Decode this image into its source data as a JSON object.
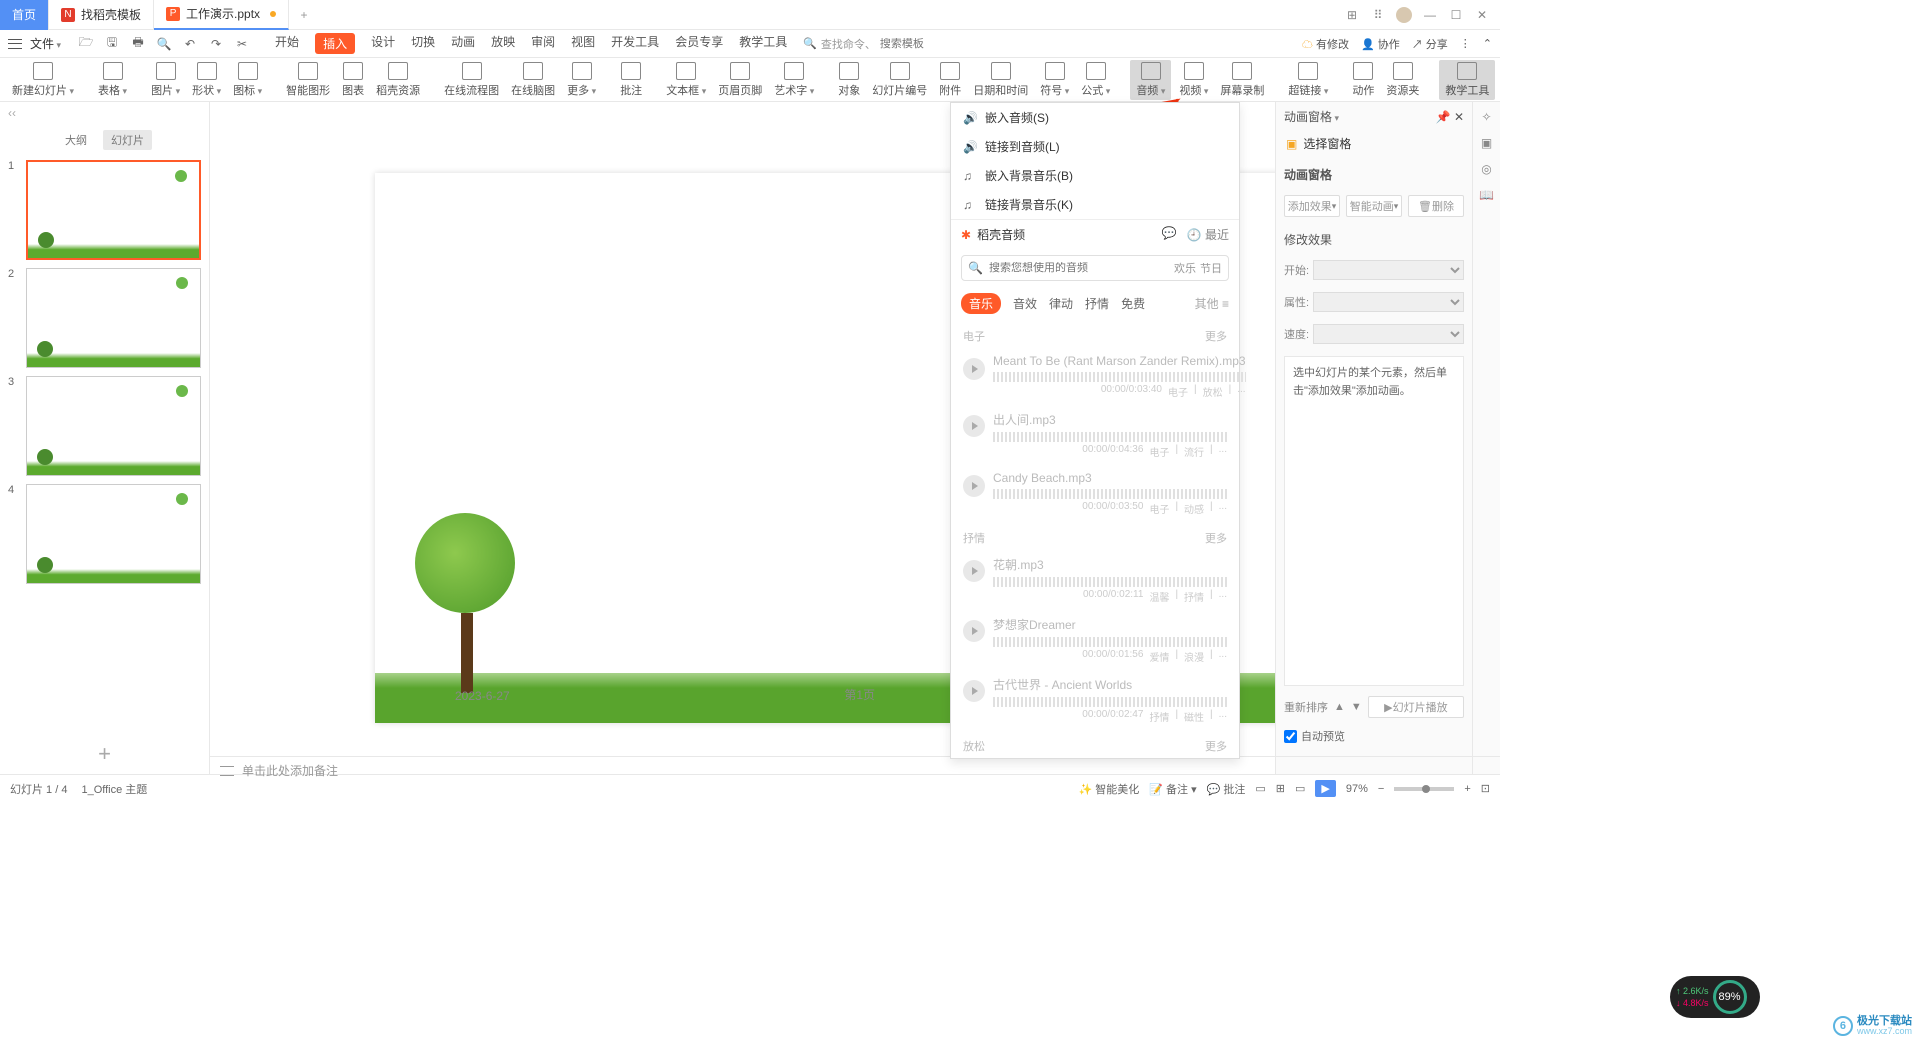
{
  "titlebar": {
    "home": "首页",
    "tab_template": "找稻壳模板",
    "tab_doc": "工作演示.pptx"
  },
  "menubar": {
    "file": "文件",
    "tabs": [
      "开始",
      "插入",
      "设计",
      "切换",
      "动画",
      "放映",
      "审阅",
      "视图",
      "开发工具",
      "会员专享",
      "教学工具"
    ],
    "active_tab_index": 1,
    "search_prefix": "查找命令、",
    "search_placeholder": "搜索模板",
    "pending": "有修改",
    "coop": "协作",
    "share": "分享"
  },
  "ribbon": {
    "items": [
      "新建幻灯片",
      "表格",
      "图片",
      "形状",
      "图标",
      "智能图形",
      "图表",
      "稻壳资源",
      "在线流程图",
      "在线脑图",
      "更多",
      "批注",
      "文本框",
      "页眉页脚",
      "艺术字",
      "对象",
      "幻灯片编号",
      "附件",
      "日期和时间",
      "符号",
      "公式",
      "音频",
      "视频",
      "屏幕录制",
      "超链接",
      "动作",
      "资源夹",
      "教学工具"
    ]
  },
  "thumbs_tabs": {
    "outline": "大纲",
    "slides": "幻灯片"
  },
  "canvas": {
    "date": "2023-6-27",
    "pagenum": "第1页"
  },
  "audio_dropdown": {
    "menu": [
      "嵌入音频(S)",
      "链接到音频(L)",
      "嵌入背景音乐(B)",
      "链接背景音乐(K)"
    ],
    "brand": "稻壳音频",
    "recent": "最近",
    "search_placeholder": "搜索您想使用的音频",
    "tag1": "欢乐",
    "tag2": "节日",
    "cats": [
      "音乐",
      "音效",
      "律动",
      "抒情",
      "免费"
    ],
    "cat_other": "其他",
    "sections": [
      {
        "head": "电子",
        "more": "更多",
        "tracks": [
          {
            "title": "Meant To Be (Rant Marson Zander Remix).mp3",
            "duration": "00:00/0:03:40",
            "tag1": "电子",
            "tag2": "放松"
          },
          {
            "title": "出人间.mp3",
            "duration": "00:00/0:04:36",
            "tag1": "电子",
            "tag2": "流行"
          },
          {
            "title": "Candy Beach.mp3",
            "duration": "00:00/0:03:50",
            "tag1": "电子",
            "tag2": "动感"
          }
        ]
      },
      {
        "head": "抒情",
        "more": "更多",
        "tracks": [
          {
            "title": "花朝.mp3",
            "duration": "00:00/0:02:11",
            "tag1": "温馨",
            "tag2": "抒情"
          },
          {
            "title": "梦想家Dreamer",
            "duration": "00:00/0:01:56",
            "tag1": "爱情",
            "tag2": "浪漫"
          },
          {
            "title": "古代世界 - Ancient Worlds",
            "duration": "00:00/0:02:47",
            "tag1": "抒情",
            "tag2": "磁性"
          }
        ]
      },
      {
        "head": "放松",
        "more": "更多",
        "tracks": []
      }
    ]
  },
  "right_panel": {
    "title": "动画窗格",
    "select_pane": "选择窗格",
    "anim_pane": "动画窗格",
    "add_effect": "添加效果",
    "smart_anim": "智能动画",
    "delete": "删除",
    "modify": "修改效果",
    "start": "开始:",
    "prop": "属性:",
    "speed": "速度:",
    "help_text": "选中幻灯片的某个元素，然后单击\"添加效果\"添加动画。",
    "reorder": "重新排序",
    "slide_play": "幻灯片播放",
    "auto_preview": "自动预览"
  },
  "notes": {
    "placeholder": "单击此处添加备注"
  },
  "statusbar": {
    "slide_count": "幻灯片 1 / 4",
    "theme": "1_Office 主题",
    "beautify": "智能美化",
    "backup": "备注",
    "review": "批注",
    "zoom": "97%"
  },
  "net_widget": {
    "up": "2.6K/s",
    "down": "4.8K/s",
    "pct": "89%"
  },
  "brand": {
    "text": "极光下载站",
    "url": "www.xz7.com"
  }
}
